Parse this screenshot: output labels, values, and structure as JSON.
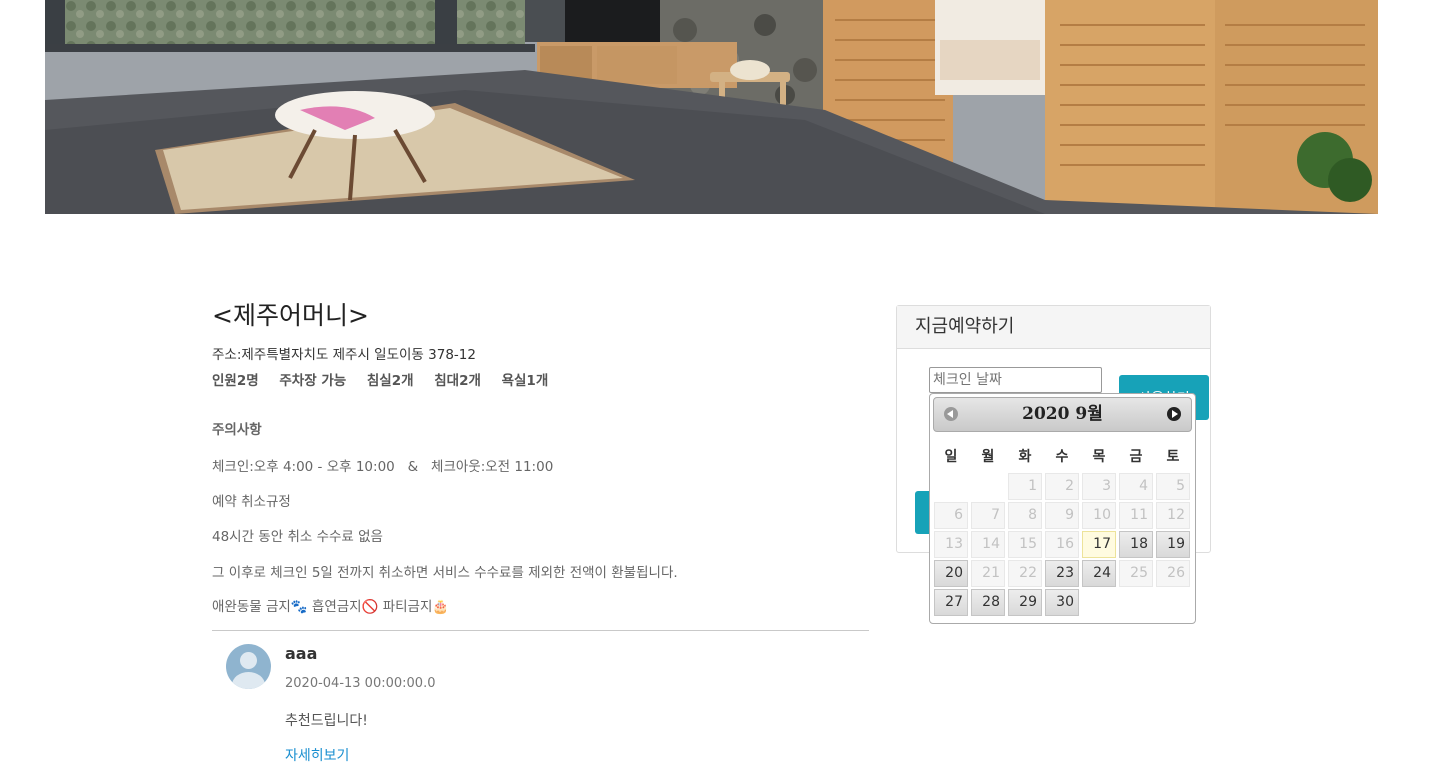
{
  "listing": {
    "title": "<제주어머니>",
    "address": "주소:제주특별자치도 제주시 일도이동 378-12",
    "amenities": [
      "인원2명",
      "주차장 가능",
      "침실2개",
      "침대2개",
      "욕실1개"
    ],
    "notice_heading": "주의사항",
    "checkin_info": "체크인:오후 4:00 - 오후 10:00   &   체크아웃:오전 11:00",
    "cancel_heading": "예약 취소규정",
    "cancel_rule1": "48시간 동안 취소 수수료 없음",
    "cancel_rule2": "그 이후로 체크인 5일 전까지 취소하면 서비스 수수료를 제외한 전액이 환불됩니다.",
    "restrictions": "애완동물 금지🐾 흡연금지🚫 파티금지🎂"
  },
  "review": {
    "name": "aaa",
    "date": "2020-04-13 00:00:00.0",
    "text": "추천드립니다!",
    "more_link": "자세히보기"
  },
  "booking": {
    "header": "지금예약하기",
    "checkin_placeholder": "체크인 날짜",
    "check_button": "사용하기"
  },
  "calendar": {
    "title": "2020 9월",
    "weekdays": [
      "일",
      "월",
      "화",
      "수",
      "목",
      "금",
      "토"
    ],
    "first_weekday_index": 2,
    "days_in_month": 30,
    "today": 17,
    "selectable": [
      18,
      19,
      20,
      23,
      24,
      27,
      28,
      29,
      30
    ]
  }
}
